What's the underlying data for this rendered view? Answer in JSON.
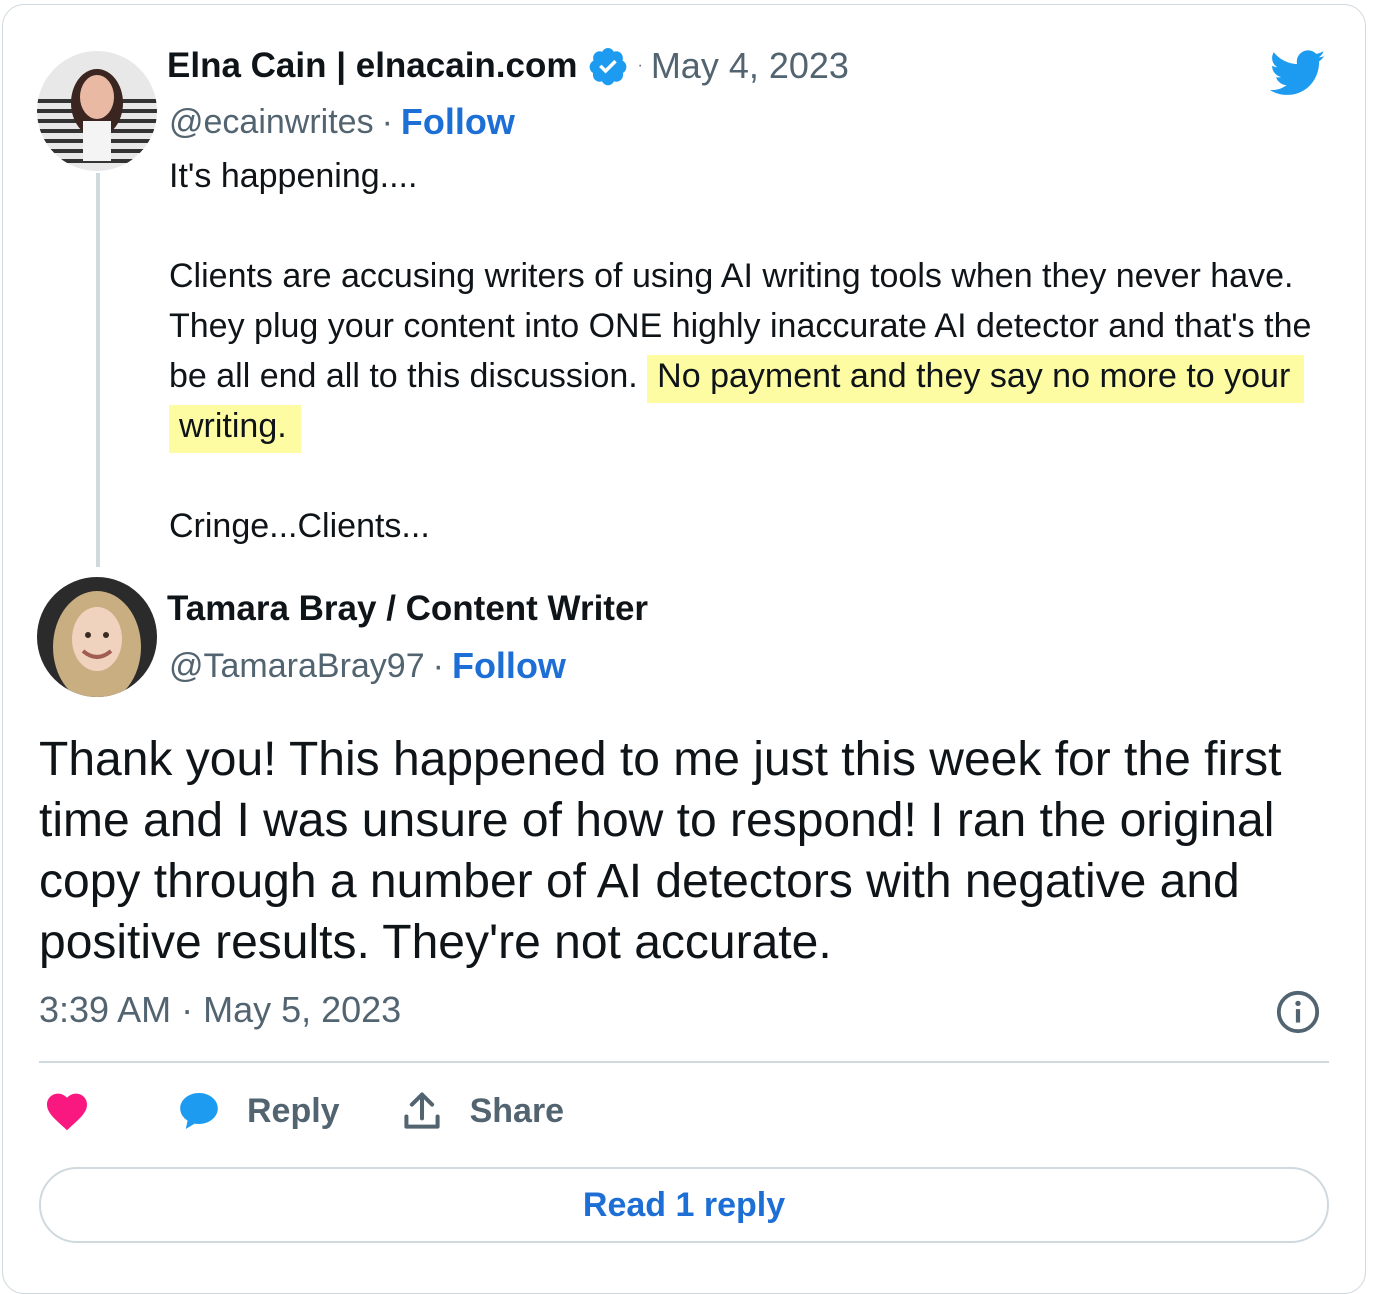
{
  "colors": {
    "follow_blue": "#1d6fd6",
    "twitter_blue": "#1d9bf0",
    "heart_pink": "#f91880",
    "highlight_yellow": "#fefca3",
    "muted_gray": "#536471"
  },
  "original_tweet": {
    "author_name": "Elna Cain | elnacain.com",
    "verified": true,
    "date": "May 4, 2023",
    "handle": "@ecainwrites",
    "follow_label": "Follow",
    "text_intro": "It's happening....",
    "text_body_plain": "Clients are accusing writers of using AI writing tools when they never have. They plug your content into ONE highly inaccurate AI detector and that's the be all end all to this discussion.",
    "text_body_highlight": "No payment and they say no more to your writing.",
    "text_outro": "Cringe...Clients..."
  },
  "reply_tweet": {
    "author_name": "Tamara Bray / Content Writer",
    "handle": "@TamaraBray97",
    "follow_label": "Follow",
    "text": "Thank you! This happened to me just this week for the first time and I was unsure of how to respond! I ran the original copy through a number of AI detectors with negative and positive results. They're not accurate.",
    "timestamp": "3:39 AM · May 5, 2023"
  },
  "actions": {
    "like_icon": "heart-icon",
    "reply_label": "Reply",
    "share_label": "Share"
  },
  "read_replies_label": "Read 1 reply",
  "separator": "·"
}
